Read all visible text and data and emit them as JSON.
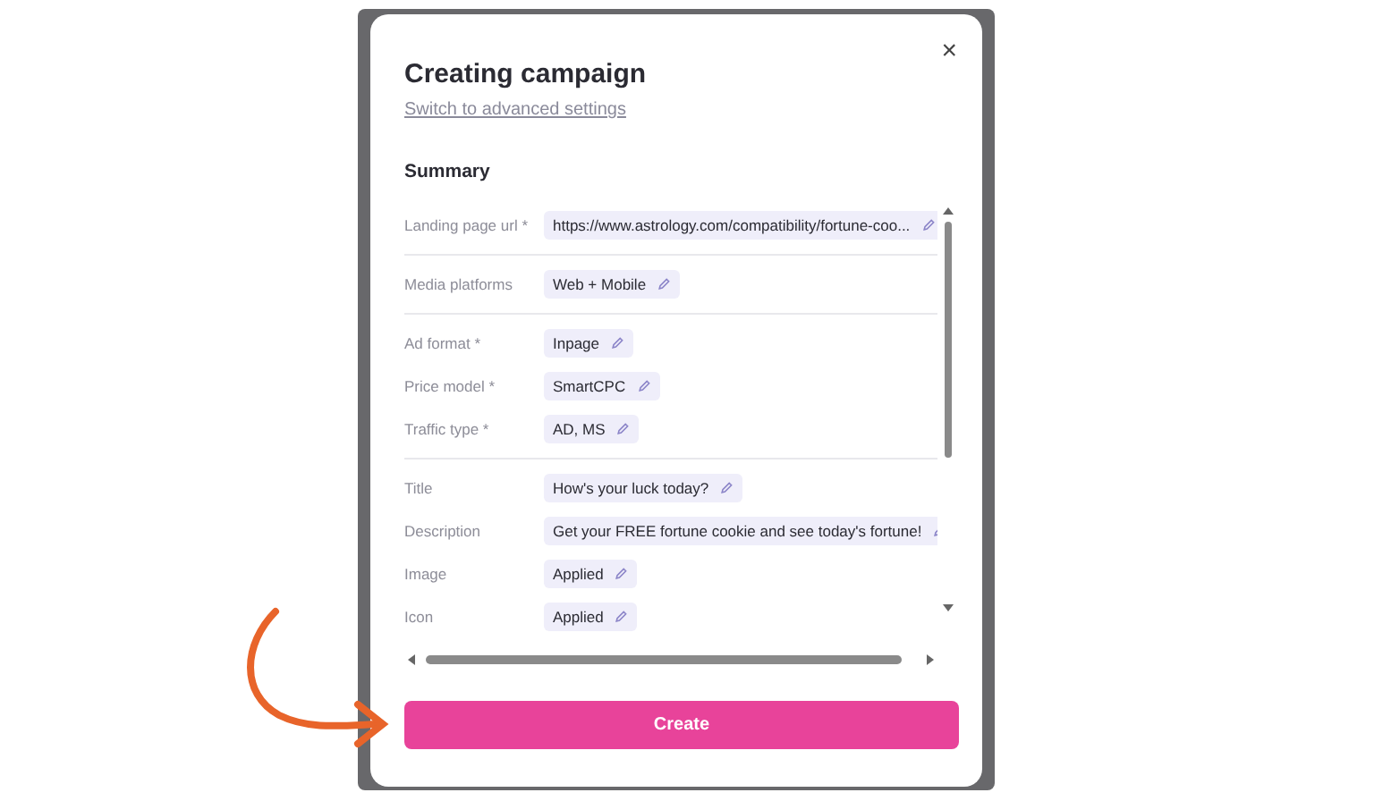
{
  "dialog": {
    "title": "Creating campaign",
    "close": "×",
    "advanced_link": "Switch to advanced settings",
    "section": "Summary",
    "groups": [
      {
        "rows": [
          {
            "label": "Landing page url *",
            "value": "https://www.astrology.com/compatibility/fortune-coo..."
          }
        ]
      },
      {
        "rows": [
          {
            "label": "Media platforms",
            "value": "Web + Mobile"
          }
        ]
      },
      {
        "rows": [
          {
            "label": "Ad format *",
            "value": "Inpage"
          },
          {
            "label": "Price model *",
            "value": "SmartCPC"
          },
          {
            "label": "Traffic type *",
            "value": "AD, MS"
          }
        ]
      },
      {
        "rows": [
          {
            "label": "Title",
            "value": "How's your luck today?"
          },
          {
            "label": "Description",
            "value": "Get your FREE fortune cookie and see today's fortune!"
          },
          {
            "label": "Image",
            "value": "Applied"
          },
          {
            "label": "Icon",
            "value": "Applied"
          }
        ]
      }
    ],
    "create_button": "Create"
  }
}
